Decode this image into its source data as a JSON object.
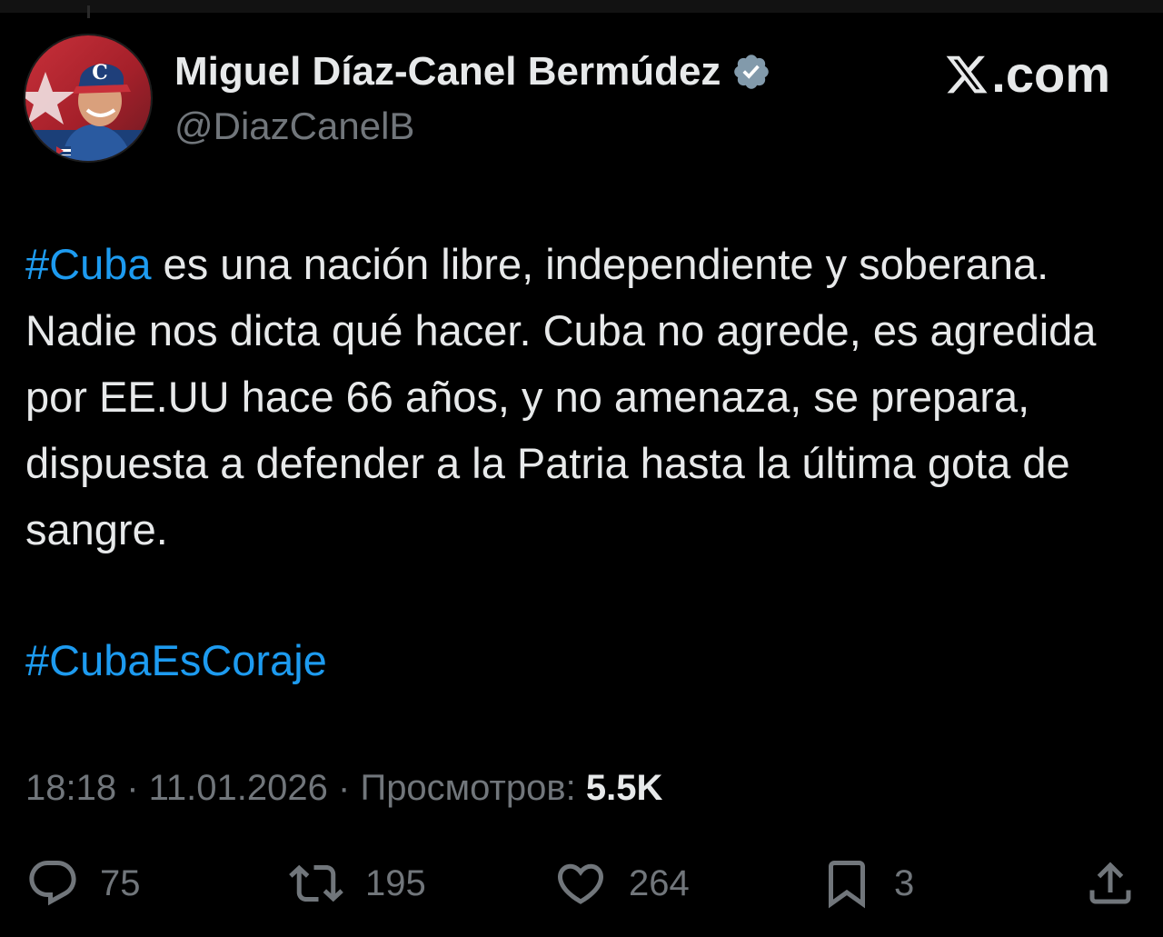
{
  "author": {
    "name": "Miguel Díaz-Canel Bermúdez",
    "handle": "@DiazCanelB",
    "verified_icon": "verified-badge-icon",
    "avatar_icon": "avatar-photo"
  },
  "brand": {
    "label": ".com",
    "icon": "x-logo-icon"
  },
  "tweet": {
    "hashtag_1": "#Cuba",
    "text_1": " es una nación libre, independiente y soberana. Nadie nos dicta qué hacer. Cuba no agrede, es agredida por EE.UU hace 66 años, y no amenaza, se prepara, dispuesta a defender a la Patria hasta la última gota de sangre.",
    "hashtag_2": "#CubaEsCoraje"
  },
  "meta": {
    "time": "18:18",
    "separator": " · ",
    "date": "11.01.2026",
    "views_label": "Просмотров:",
    "views_count": "5.5K"
  },
  "actions": {
    "replies": "75",
    "reposts": "195",
    "likes": "264",
    "bookmarks": "3"
  },
  "colors": {
    "background": "#000000",
    "text": "#e7e9ea",
    "muted": "#71767b",
    "accent": "#1d9bf0",
    "verified": "#829aab"
  }
}
